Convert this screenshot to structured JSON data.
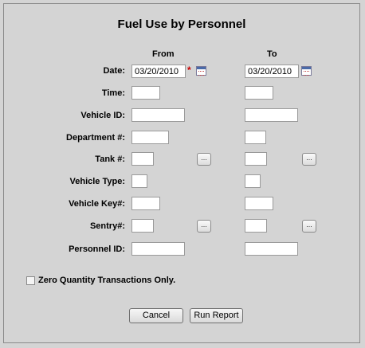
{
  "title": "Fuel Use by Personnel",
  "columns": {
    "from": "From",
    "to": "To"
  },
  "required_marker": "*",
  "ellipsis": "...",
  "fields": {
    "date": {
      "label": "Date:",
      "from_value": "03/20/2010",
      "to_value": "03/20/2010"
    },
    "time": {
      "label": "Time:",
      "from_value": "",
      "to_value": ""
    },
    "vehicle_id": {
      "label": "Vehicle ID:",
      "from_value": "",
      "to_value": ""
    },
    "department": {
      "label": "Department #:",
      "from_value": "",
      "to_value": ""
    },
    "tank": {
      "label": "Tank #:",
      "from_value": "",
      "to_value": ""
    },
    "vehicle_type": {
      "label": "Vehicle Type:",
      "from_value": "",
      "to_value": ""
    },
    "vehicle_key": {
      "label": "Vehicle Key#:",
      "from_value": "",
      "to_value": ""
    },
    "sentry": {
      "label": "Sentry#:",
      "from_value": "",
      "to_value": ""
    },
    "personnel_id": {
      "label": "Personnel ID:",
      "from_value": "",
      "to_value": ""
    }
  },
  "zero_quantity": {
    "label": "Zero Quantity Transactions Only.",
    "checked": false
  },
  "buttons": {
    "cancel": "Cancel",
    "run_report": "Run Report"
  },
  "icons": {
    "calendar": "calendar-icon"
  }
}
